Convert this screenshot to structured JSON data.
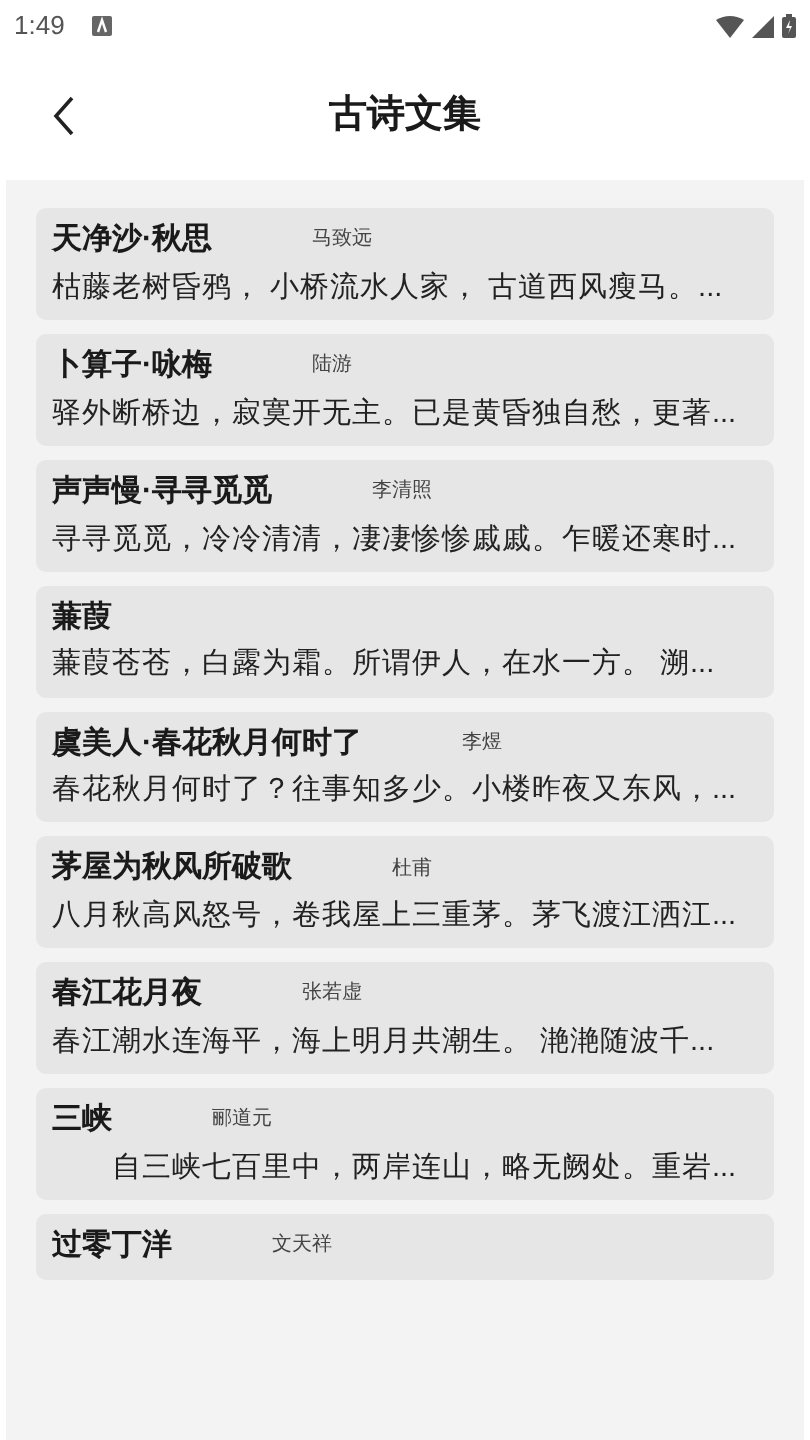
{
  "status_bar": {
    "time": "1:49"
  },
  "header": {
    "title": "古诗文集"
  },
  "poems": [
    {
      "title": "天净沙·秋思",
      "author": "马致远",
      "excerpt": "枯藤老树昏鸦， 小桥流水人家， 古道西风瘦马。..."
    },
    {
      "title": "卜算子·咏梅",
      "author": "陆游",
      "excerpt": "驿外断桥边，寂寞开无主。已是黄昏独自愁，更著..."
    },
    {
      "title": "声声慢·寻寻觅觅",
      "author": "李清照",
      "excerpt": "寻寻觅觅，冷冷清清，凄凄惨惨戚戚。乍暖还寒时..."
    },
    {
      "title": "蒹葭",
      "excerpt": "蒹葭苍苍，白露为霜。所谓伊人，在水一方。 溯..."
    },
    {
      "title": "虞美人·春花秋月何时了",
      "author": "李煜",
      "excerpt": "春花秋月何时了？往事知多少。小楼昨夜又东风，..."
    },
    {
      "title": "茅屋为秋风所破歌",
      "author": "杜甫",
      "excerpt": "八月秋高风怒号，卷我屋上三重茅。茅飞渡江洒江..."
    },
    {
      "title": "春江花月夜",
      "author": "张若虚",
      "excerpt": "春江潮水连海平，海上明月共潮生。 滟滟随波千..."
    },
    {
      "title": "三峡",
      "author": "郦道元",
      "excerpt": "　　自三峡七百里中，两岸连山，略无阙处。重岩..."
    },
    {
      "title": "过零丁洋",
      "author": "文天祥"
    }
  ]
}
